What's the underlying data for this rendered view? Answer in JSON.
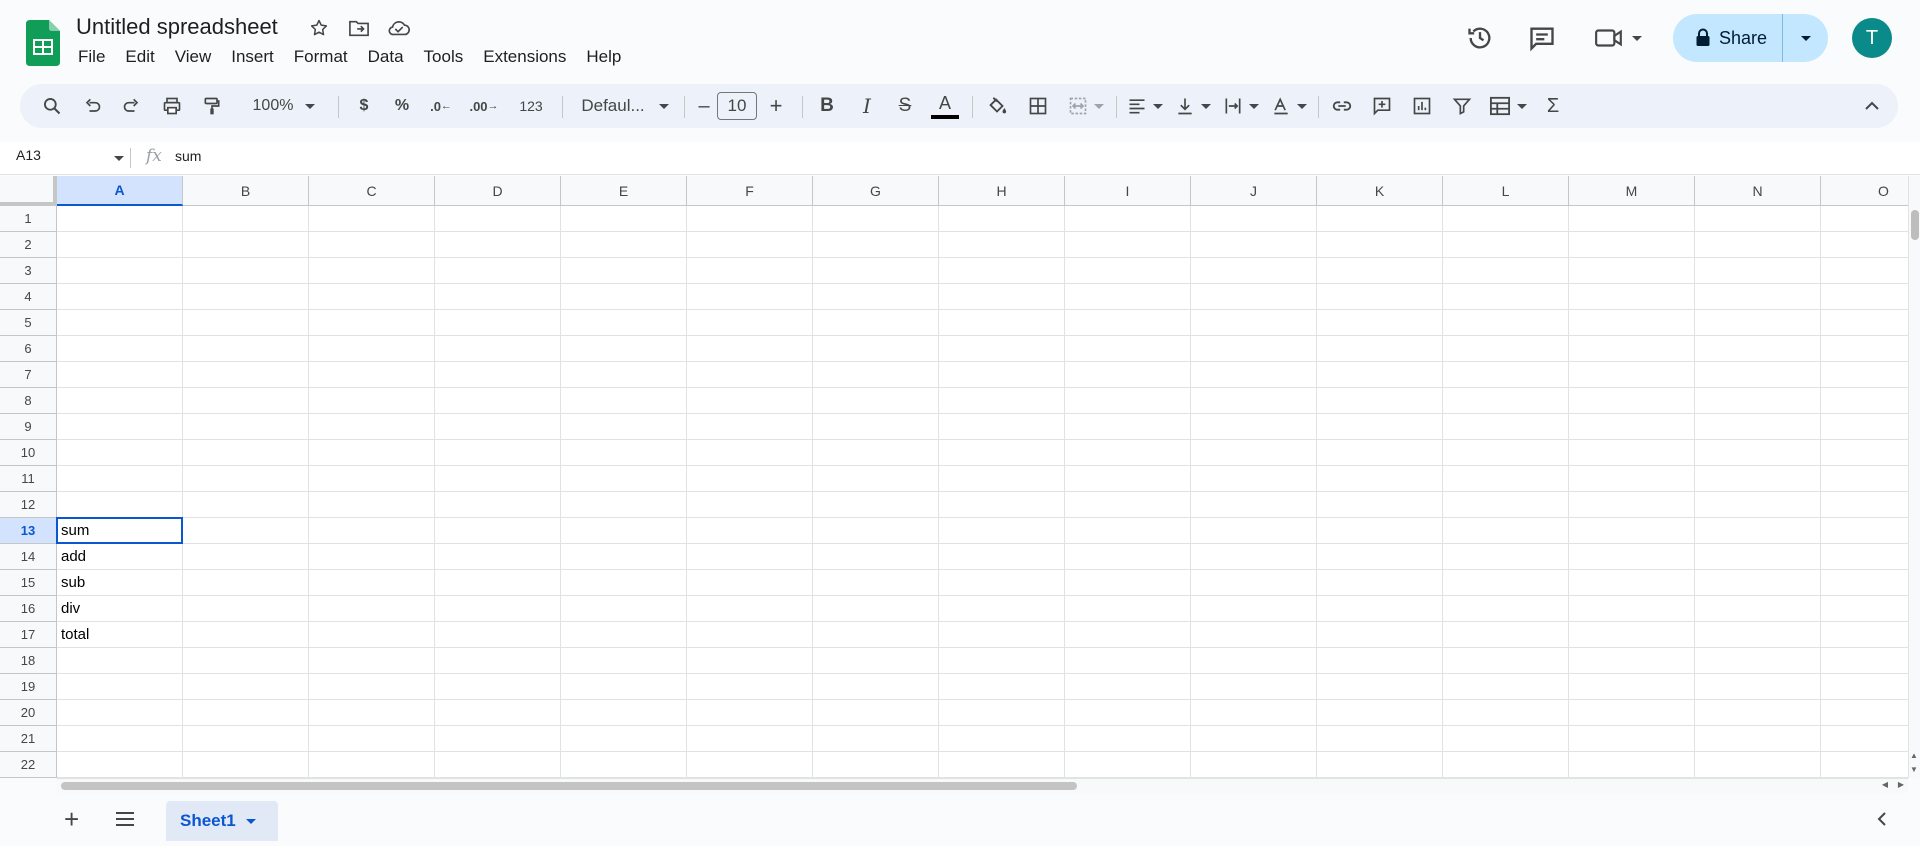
{
  "app": {
    "title": "Untitled spreadsheet",
    "menu": [
      "File",
      "Edit",
      "View",
      "Insert",
      "Format",
      "Data",
      "Tools",
      "Extensions",
      "Help"
    ],
    "share_label": "Share",
    "avatar_letter": "T",
    "brand_color": "#0f9d58",
    "accent_color": "#0b57d0"
  },
  "toolbar": {
    "zoom": "100%",
    "currency": "$",
    "percent": "%",
    "dec_decrease": ".0",
    "dec_increase": ".00",
    "number_format": "123",
    "font": "Defaul...",
    "font_size": "10",
    "minus": "–",
    "plus": "+",
    "bold": "B",
    "italic": "I",
    "strike": "S",
    "text_color": "A",
    "sum": "Σ"
  },
  "formula_bar": {
    "name_box": "A13",
    "fx": "fx",
    "value": "sum"
  },
  "grid": {
    "columns": [
      "A",
      "B",
      "C",
      "D",
      "E",
      "F",
      "G",
      "H",
      "I",
      "J",
      "K",
      "L",
      "M",
      "N",
      "O"
    ],
    "rows": [
      "1",
      "2",
      "3",
      "4",
      "5",
      "6",
      "7",
      "8",
      "9",
      "10",
      "11",
      "12",
      "13",
      "14",
      "15",
      "16",
      "17",
      "18",
      "19",
      "20",
      "21",
      "22"
    ],
    "selected_cell": "A13",
    "cells": [
      {
        "row": 13,
        "col": "A",
        "text": "sum"
      },
      {
        "row": 14,
        "col": "A",
        "text": "add"
      },
      {
        "row": 15,
        "col": "A",
        "text": "sub"
      },
      {
        "row": 16,
        "col": "A",
        "text": "div"
      },
      {
        "row": 17,
        "col": "A",
        "text": "total"
      }
    ]
  },
  "sheets": {
    "add": "+",
    "active": "Sheet1"
  }
}
